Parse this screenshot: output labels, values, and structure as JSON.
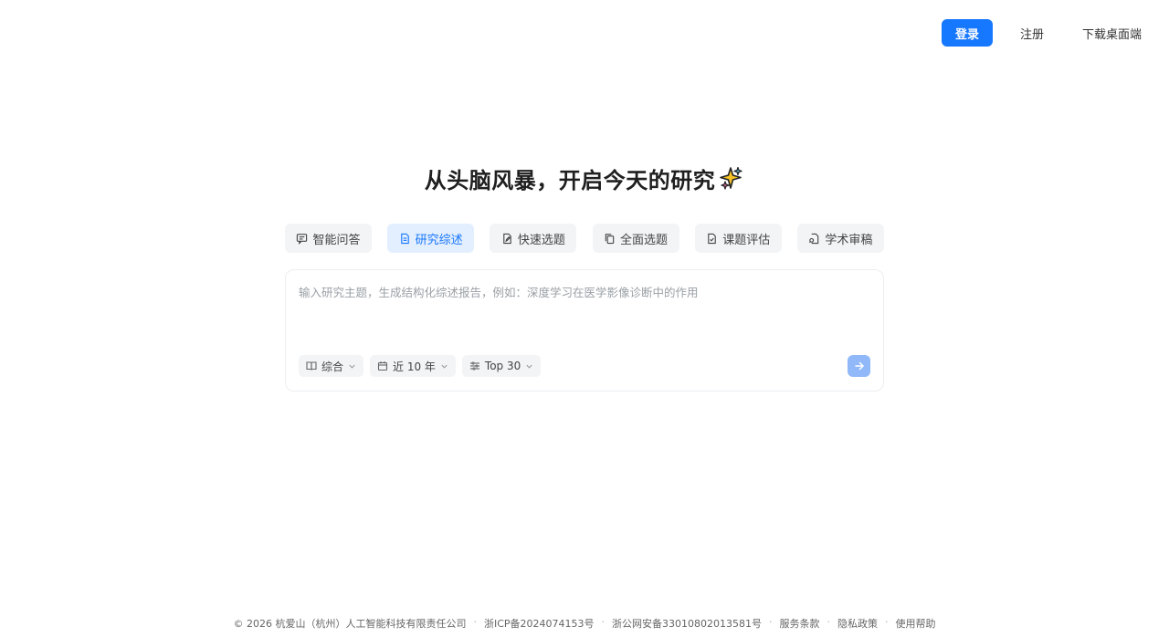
{
  "nav": {
    "login": "登录",
    "register": "注册",
    "download": "下载桌面端",
    "accent": "#1677ff"
  },
  "hero": {
    "title": "从头脑风暴，开启今天的研究",
    "sparkle_icon": "sparkle-icon"
  },
  "tabs": [
    {
      "label": "智能问答",
      "icon": "chat-icon",
      "active": false
    },
    {
      "label": "研究综述",
      "icon": "document-icon",
      "active": true
    },
    {
      "label": "快速选题",
      "icon": "edit-doc-icon",
      "active": false
    },
    {
      "label": "全面选题",
      "icon": "copy-icon",
      "active": false
    },
    {
      "label": "课题评估",
      "icon": "assess-doc-icon",
      "active": false
    },
    {
      "label": "学术审稿",
      "icon": "review-doc-icon",
      "active": false
    }
  ],
  "input": {
    "placeholder": "输入研究主题，生成结构化综述报告，例如：深度学习在医学影像诊断中的作用",
    "value": ""
  },
  "filters": [
    {
      "label": "综合",
      "icon": "book-icon"
    },
    {
      "label": "近 10 年",
      "icon": "calendar-icon"
    },
    {
      "label": "Top 30",
      "icon": "sliders-icon"
    }
  ],
  "send_icon": "arrow-right-icon",
  "footer": [
    "© 2026 杭爱山（杭州）人工智能科技有限责任公司",
    "浙ICP备2024074153号",
    "浙公网安备33010802013581号",
    "服务条款",
    "隐私政策",
    "使用帮助"
  ]
}
